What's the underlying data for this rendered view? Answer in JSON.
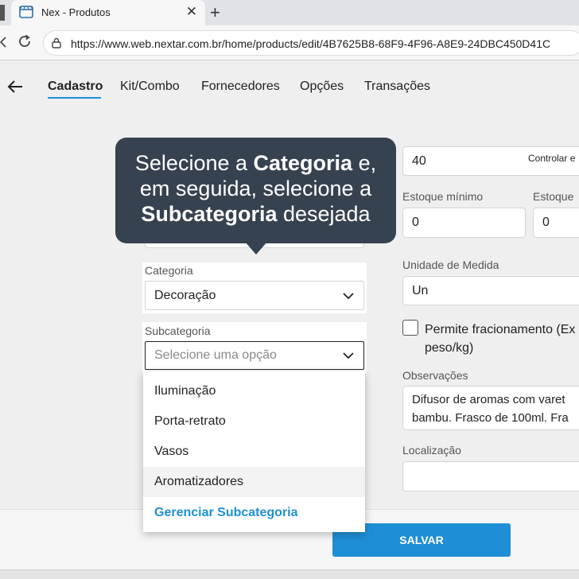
{
  "browser": {
    "tab_title": "Nex - Produtos",
    "close_glyph": "✕",
    "new_tab_glyph": "+",
    "url": "https://www.web.nextar.com.br/home/products/edit/4B7625B8-68F9-4F96-A8E9-24DBC450D41C"
  },
  "nav": {
    "tabs": [
      "Cadastro",
      "Kit/Combo",
      "Fornecedores",
      "Opções",
      "Transações"
    ]
  },
  "tooltip": {
    "line1_a": "Selecione a ",
    "line1_b": "Categoria",
    "line1_c": " e,",
    "line2": "em seguida, selecione a",
    "line3_a": "Subcategoria",
    "line3_b": " desejada"
  },
  "form": {
    "stock_value": "40",
    "control_label": "Controlar e",
    "min_stock_label": "Estoque mínimo",
    "min_stock_value": "0",
    "max_stock_label": "Estoque",
    "max_stock_value": "0",
    "category_label": "Categoria",
    "category_value": "Decoração",
    "subcategory_label": "Subcategoria",
    "subcategory_placeholder": "Selecione uma opção",
    "unit_label": "Unidade de Medida",
    "unit_value": "Un",
    "fraction_label_1": "Permite fracionamento (Ex",
    "fraction_label_2": "peso/kg)",
    "notes_label": "Observações",
    "notes_line1": "Difusor de aromas com varet",
    "notes_line2": "bambu. Frasco de 100ml. Fra",
    "location_label": "Localização",
    "location_value": ""
  },
  "dropdown": {
    "options": [
      "Iluminação",
      "Porta-retrato",
      "Vasos",
      "Aromatizadores"
    ],
    "manage_label": "Gerenciar Subcategoria"
  },
  "footer": {
    "save_label": "SALVAR"
  },
  "colors": {
    "accent": "#1e8fd6",
    "tooltip_bg": "#374250"
  }
}
